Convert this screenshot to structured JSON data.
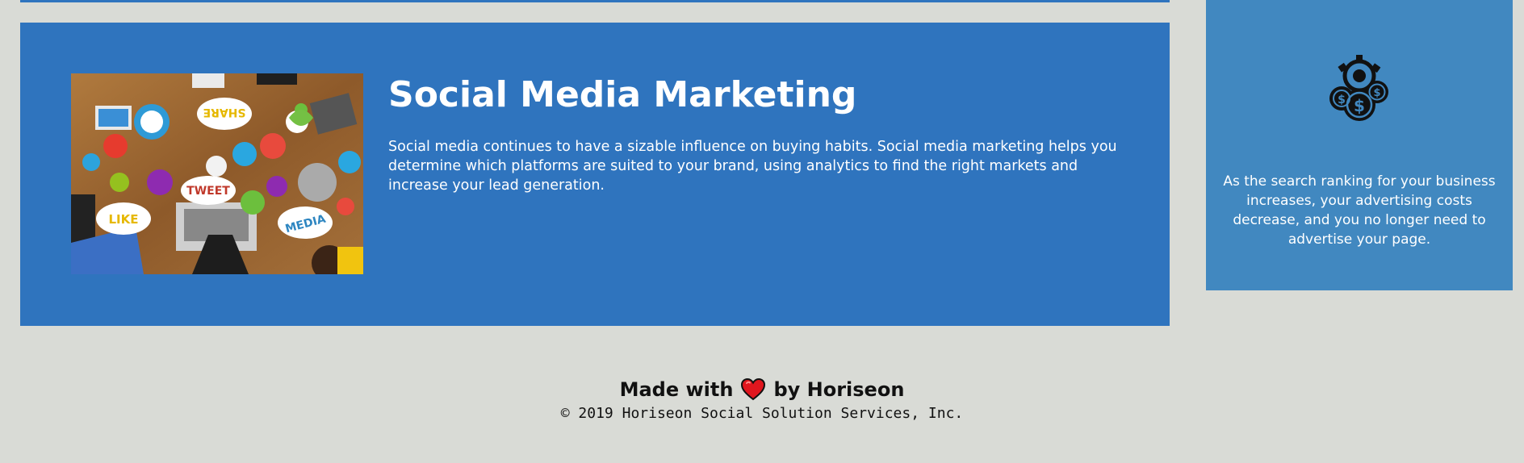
{
  "main": {
    "card": {
      "title": "Social Media Marketing",
      "text": "Social media continues to have a sizable influence on buying habits. Social media marketing helps you determine which platforms are suited to your brand, using analytics to find the right markets and increase your lead generation.",
      "image": {
        "icon": "social-media-collage-image",
        "labels": [
          "SHARE",
          "TWEET",
          "LIKE",
          "MEDIA"
        ]
      }
    }
  },
  "sidebar": {
    "benefit": {
      "icon": "cost-management-icon",
      "text": "As the search ranking for your business increases, your advertising costs decrease, and you no longer need to advertise your page."
    }
  },
  "footer": {
    "made_with": "Made with",
    "by": "by Horiseon",
    "heart_icon": "heart-icon",
    "copyright": "© 2019 Horiseon Social Solution Services, Inc."
  },
  "colors": {
    "background": "#d9dbd6",
    "card": "#2f74be",
    "benefit": "#4188c0",
    "heart": "#e0161e"
  }
}
